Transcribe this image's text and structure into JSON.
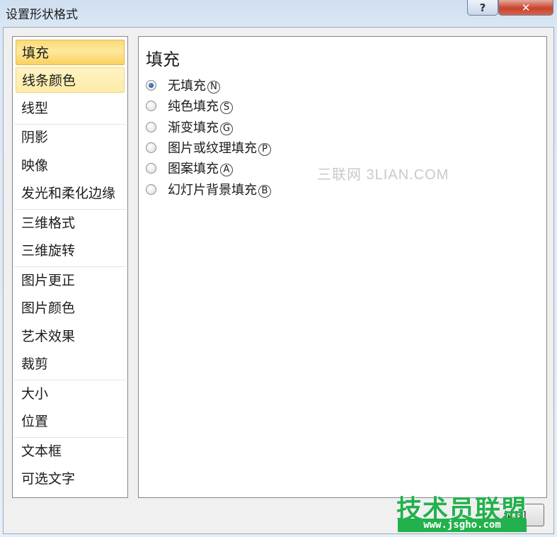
{
  "window": {
    "title": "设置形状格式",
    "help_label": "?",
    "close_label": "✕"
  },
  "sidebar": {
    "items": [
      {
        "label": "填充",
        "state": "active"
      },
      {
        "label": "线条颜色",
        "state": "hover"
      },
      {
        "label": "线型"
      },
      {
        "label": "阴影"
      },
      {
        "label": "映像"
      },
      {
        "label": "发光和柔化边缘"
      },
      {
        "label": "三维格式"
      },
      {
        "label": "三维旋转"
      },
      {
        "label": "图片更正"
      },
      {
        "label": "图片颜色"
      },
      {
        "label": "艺术效果"
      },
      {
        "label": "裁剪"
      },
      {
        "label": "大小"
      },
      {
        "label": "位置"
      },
      {
        "label": "文本框"
      },
      {
        "label": "可选文字"
      }
    ]
  },
  "panel": {
    "title": "填充",
    "options": [
      {
        "label": "无填充",
        "key": "N",
        "selected": true
      },
      {
        "label": "纯色填充",
        "key": "S",
        "selected": false
      },
      {
        "label": "渐变填充",
        "key": "G",
        "selected": false
      },
      {
        "label": "图片或纹理填充",
        "key": "P",
        "selected": false
      },
      {
        "label": "图案填充",
        "key": "A",
        "selected": false
      },
      {
        "label": "幻灯片背景填充",
        "key": "B",
        "selected": false
      }
    ]
  },
  "footer": {
    "close_label": "关闭"
  },
  "watermarks": {
    "site_text": "三联网 3LIAN.COM",
    "logo_text": "技术员联盟",
    "logo_url": "www.jsgho.com"
  },
  "colors": {
    "active_item": "#fbdb7a",
    "radio_dot": "#1d4f94",
    "logo_green": "#22b14c"
  }
}
